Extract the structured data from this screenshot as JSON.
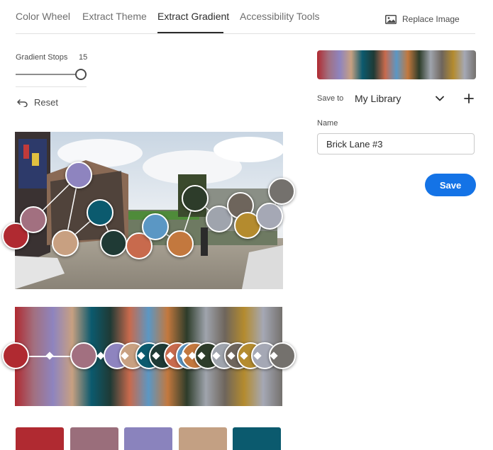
{
  "tabs": [
    {
      "label": "Color Wheel"
    },
    {
      "label": "Extract Theme"
    },
    {
      "label": "Extract Gradient"
    },
    {
      "label": "Accessibility Tools"
    }
  ],
  "replace_image": {
    "label": "Replace Image",
    "icon": "image-icon"
  },
  "gradient_stops": {
    "label": "Gradient Stops",
    "value": "15",
    "level": 1.0
  },
  "reset": {
    "label": "Reset",
    "icon": "undo-icon"
  },
  "save_to": {
    "label": "Save to",
    "library": "My Library",
    "icon": "chevron-down-icon",
    "add_icon": "plus-icon"
  },
  "name": {
    "label": "Name",
    "value": "Brick Lane #3"
  },
  "save_label": "Save",
  "colors": {
    "accent": "#1473e6",
    "stops": [
      "#b02a31",
      "#a27080",
      "#8e84bf",
      "#c8a081",
      "#0b5a6e",
      "#1f3a35",
      "#c86a4d",
      "#5b97c4",
      "#c3783e",
      "#2d3c2a",
      "#9fa4ad",
      "#6e655c",
      "#b48b2e",
      "#a5a8b5",
      "#74716d"
    ]
  },
  "swatches": [
    "#b02a31",
    "#9a6e7b",
    "#8a83bd",
    "#c3a083",
    "#0b5a6e"
  ]
}
